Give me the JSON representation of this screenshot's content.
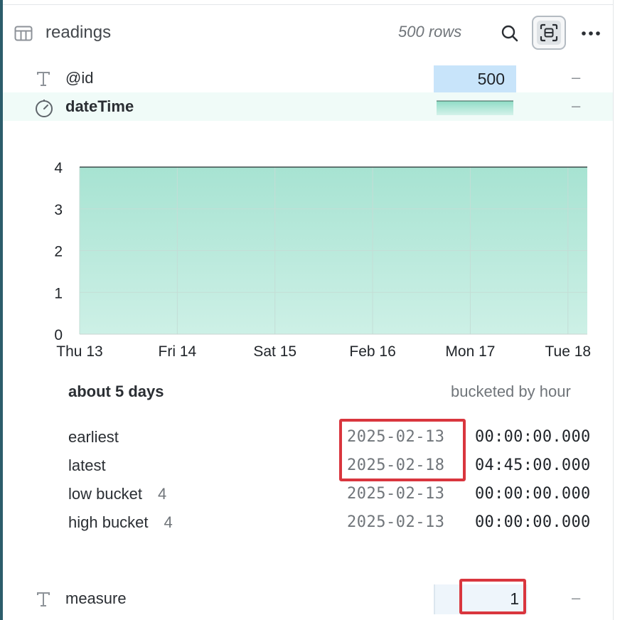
{
  "header": {
    "title": "readings",
    "row_count": "500 rows",
    "icons": {
      "table": "table-icon",
      "search": "search-icon",
      "focus": "focus-mode-icon",
      "more": "more-icon"
    }
  },
  "columns": [
    {
      "name": "@id",
      "type_icon": "text-type-icon",
      "value": "500",
      "dash": "–"
    },
    {
      "name": "dateTime",
      "type_icon": "clock-type-icon",
      "dash": "–"
    }
  ],
  "chart_data": {
    "type": "area",
    "x_tick_labels": [
      "Thu 13",
      "Fri 14",
      "Sat 15",
      "Feb 16",
      "Mon 17",
      "Tue 18"
    ],
    "y_tick_labels": [
      "0",
      "1",
      "2",
      "3",
      "4"
    ],
    "ylim": [
      0,
      4
    ],
    "x_range_days": [
      0,
      5.198
    ],
    "series": [
      {
        "x_days": [
          0,
          5.198
        ],
        "values": [
          4,
          4
        ]
      }
    ],
    "grid": true,
    "colors": {
      "fill_top": "#a7e3d2",
      "fill_bottom": "#cdf0e6",
      "line": "#1e2a2a",
      "grid": "#c4ddd6"
    }
  },
  "summary": {
    "span": "about 5 days",
    "bucketing": "bucketed by hour"
  },
  "stats": [
    {
      "label": "earliest",
      "count": "",
      "date": "2025-02-13",
      "time": "00:00:00.000"
    },
    {
      "label": "latest",
      "count": "",
      "date": "2025-02-18",
      "time": "04:45:00.000"
    },
    {
      "label": "low bucket",
      "count": "4",
      "date": "2025-02-13",
      "time": "00:00:00.000"
    },
    {
      "label": "high bucket",
      "count": "4",
      "date": "2025-02-13",
      "time": "00:00:00.000"
    }
  ],
  "measure": {
    "name": "measure",
    "type_icon": "text-type-icon",
    "value": "1",
    "dash": "–"
  },
  "highlight_color": "#d9363e"
}
